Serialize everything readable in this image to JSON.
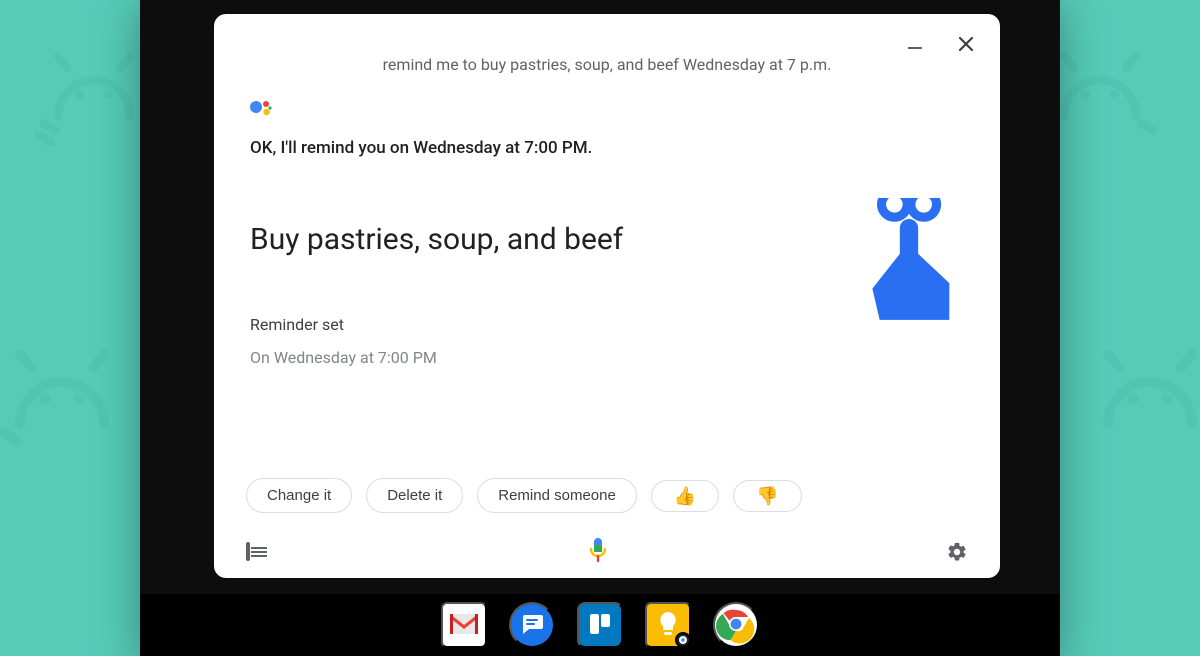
{
  "user_query": "remind me to buy pastries, soup, and beef Wednesday at 7 p.m.",
  "assistant_reply": "OK, I'll remind you on Wednesday at 7:00 PM.",
  "reminder": {
    "title": "Buy pastries, soup, and beef",
    "status_label": "Reminder set",
    "status_detail": "On Wednesday at 7:00 PM"
  },
  "chips": {
    "change": "Change it",
    "delete": "Delete it",
    "remind_someone": "Remind someone",
    "thumbs_up": "👍",
    "thumbs_down": "👎"
  },
  "colors": {
    "accent": "#2a6ef1",
    "bg": "#56cbb8"
  },
  "taskbar": {
    "apps": [
      "gmail",
      "messages",
      "trello",
      "keep",
      "chrome"
    ]
  }
}
